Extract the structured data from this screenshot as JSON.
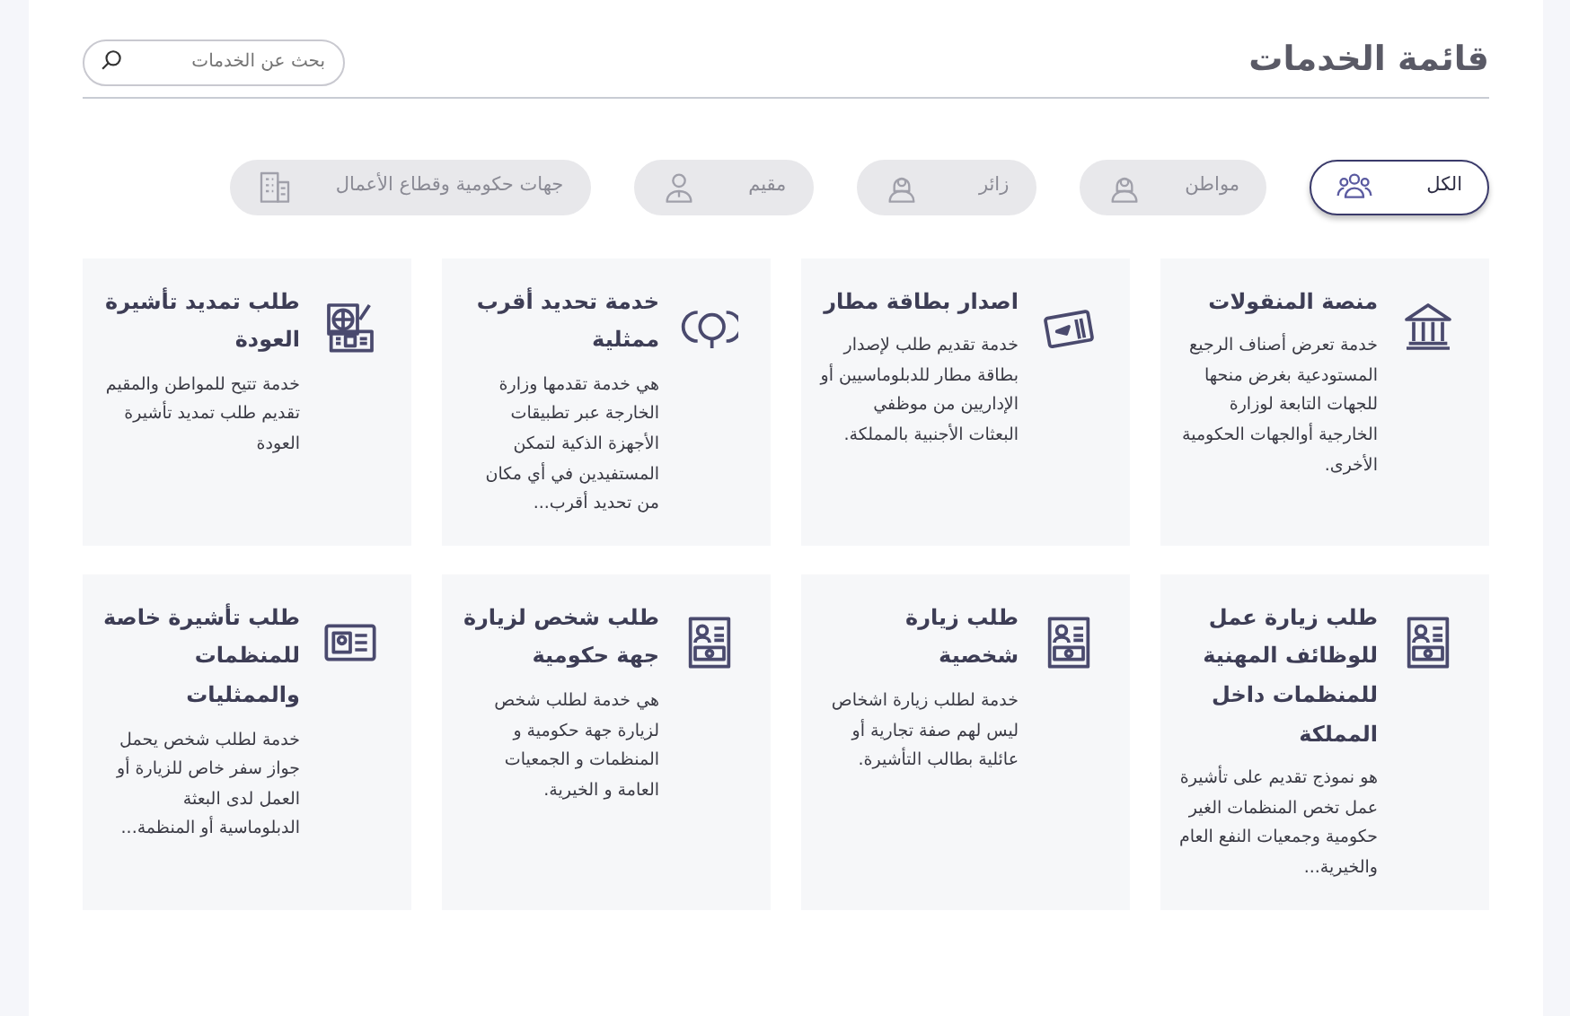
{
  "header": {
    "title": "قائمة الخدمات",
    "search": {
      "placeholder": "بحث عن الخدمات"
    }
  },
  "filters": [
    {
      "label": "الكل",
      "selected": true,
      "kind": "group"
    },
    {
      "label": "مواطن",
      "selected": false,
      "kind": "woman"
    },
    {
      "label": "زائر",
      "selected": false,
      "kind": "woman"
    },
    {
      "label": "مقيم",
      "selected": false,
      "kind": "man"
    },
    {
      "label": "جهات حكومية وقطاع الأعمال",
      "selected": false,
      "kind": "building"
    }
  ],
  "services": [
    {
      "title": "منصة المنقولات",
      "description": "خدمة تعرض أصناف الرجيع المستودعية بغرض منحها للجهات التابعة لوزارة الخارجية أوالجهات الحكومية الأخرى.",
      "kind": "institution"
    },
    {
      "title": "اصدار بطاقة مطار",
      "description": "خدمة تقديم طلب لإصدار بطاقة مطار للدبلوماسيين أو الإداريين من موظفي البعثات الأجنبية بالمملكة.",
      "kind": "ticket"
    },
    {
      "title": "خدمة تحديد أقرب ممثلية",
      "description": "هي خدمة تقدمها وزارة الخارجة عبر تطبيقات الأجهزة الذكية لتمكن المستفيدين في أي مكان من تحديد أقرب...",
      "kind": "locator"
    },
    {
      "title": "طلب تمديد تأشيرة العودة",
      "description": "خدمة تتيح للمواطن والمقيم تقديم طلب تمديد تأشيرة العودة",
      "kind": "passport"
    },
    {
      "title": "طلب زيارة عمل للوظائف المهنية للمنظمات داخل المملكة",
      "description": "هو نموذج تقديم على تأشيرة عمل تخص المنظمات الغير حكومية وجمعيات النفع العام والخيرية...",
      "kind": "document"
    },
    {
      "title": "طلب زيارة شخصية",
      "description": "خدمة لطلب زيارة اشخاص ليس لهم صفة تجارية أو عائلية بطالب التأشيرة.",
      "kind": "document"
    },
    {
      "title": "طلب شخص لزيارة جهة حكومية",
      "description": "هي خدمة لطلب شخص لزيارة جهة حكومية و المنظمات و الجمعيات العامة و الخيرية.",
      "kind": "document"
    },
    {
      "title": "طلب تأشيرة خاصة للمنظمات والممثليات",
      "description": "خدمة لطلب شخص يحمل جواز سفر خاص للزيارة أو العمل لدى البعثة الدبلوماسية أو المنظمة...",
      "kind": "idcard"
    }
  ]
}
